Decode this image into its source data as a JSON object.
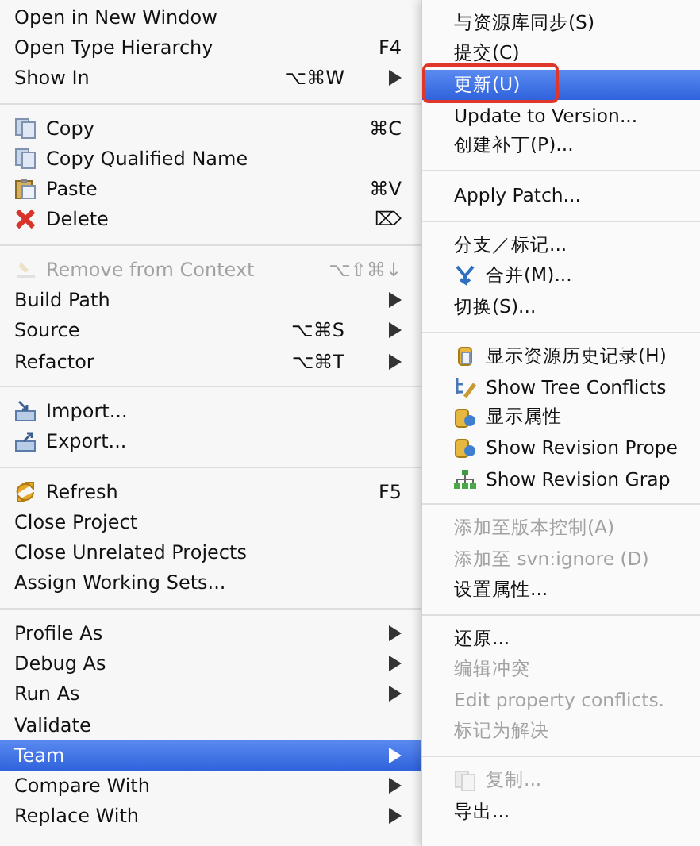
{
  "context_menu": {
    "groups": [
      [
        {
          "label": "Open in New Window",
          "submenu": false,
          "disabled": false,
          "selected": false
        },
        {
          "label": "Open Type Hierarchy",
          "shortcut": "F4",
          "submenu": false,
          "disabled": false,
          "selected": false
        },
        {
          "label": "Show In",
          "shortcut": "⌥⌘W",
          "submenu": true,
          "disabled": false,
          "selected": false
        }
      ],
      [
        {
          "label": "Copy",
          "shortcut": "⌘C",
          "submenu": false,
          "disabled": false,
          "selected": false
        },
        {
          "label": "Copy Qualified Name",
          "submenu": false,
          "disabled": false,
          "selected": false
        },
        {
          "label": "Paste",
          "shortcut": "⌘V",
          "submenu": false,
          "disabled": false,
          "selected": false
        },
        {
          "label": "Delete",
          "shortcut": "⌦",
          "submenu": false,
          "disabled": false,
          "selected": false
        }
      ],
      [
        {
          "label": "Remove from Context",
          "shortcut": "⌥⇧⌘↓",
          "submenu": false,
          "disabled": true,
          "selected": false
        },
        {
          "label": "Build Path",
          "submenu": true,
          "disabled": false,
          "selected": false
        },
        {
          "label": "Source",
          "shortcut": "⌥⌘S",
          "submenu": true,
          "disabled": false,
          "selected": false
        },
        {
          "label": "Refactor",
          "shortcut": "⌥⌘T",
          "submenu": true,
          "disabled": false,
          "selected": false
        }
      ],
      [
        {
          "label": "Import...",
          "submenu": false,
          "disabled": false,
          "selected": false
        },
        {
          "label": "Export...",
          "submenu": false,
          "disabled": false,
          "selected": false
        }
      ],
      [
        {
          "label": "Refresh",
          "shortcut": "F5",
          "submenu": false,
          "disabled": false,
          "selected": false
        },
        {
          "label": "Close Project",
          "submenu": false,
          "disabled": false,
          "selected": false
        },
        {
          "label": "Close Unrelated Projects",
          "submenu": false,
          "disabled": false,
          "selected": false
        },
        {
          "label": "Assign Working Sets...",
          "submenu": false,
          "disabled": false,
          "selected": false
        }
      ],
      [
        {
          "label": "Profile As",
          "submenu": true,
          "disabled": false,
          "selected": false
        },
        {
          "label": "Debug As",
          "submenu": true,
          "disabled": false,
          "selected": false
        },
        {
          "label": "Run As",
          "submenu": true,
          "disabled": false,
          "selected": false
        },
        {
          "label": "Validate",
          "submenu": false,
          "disabled": false,
          "selected": false
        },
        {
          "label": "Team",
          "submenu": true,
          "disabled": false,
          "selected": true
        },
        {
          "label": "Compare With",
          "submenu": true,
          "disabled": false,
          "selected": false
        },
        {
          "label": "Replace With",
          "submenu": true,
          "disabled": false,
          "selected": false
        }
      ]
    ]
  },
  "team_submenu": {
    "groups": [
      [
        {
          "label": "与资源库同步(S)",
          "disabled": false,
          "selected": false,
          "circled": false
        },
        {
          "label": "提交(C)",
          "disabled": false,
          "selected": false,
          "circled": false
        },
        {
          "label": "更新(U)",
          "disabled": false,
          "selected": true,
          "circled": true
        },
        {
          "label": "Update to Version...",
          "disabled": false,
          "selected": false,
          "circled": false
        },
        {
          "label": "创建补丁(P)...",
          "disabled": false,
          "selected": false,
          "circled": false
        }
      ],
      [
        {
          "label": "Apply Patch...",
          "disabled": false,
          "selected": false,
          "circled": false
        }
      ],
      [
        {
          "label": "分支／标记...",
          "disabled": false,
          "selected": false,
          "circled": false
        },
        {
          "label": "合并(M)...",
          "disabled": false,
          "selected": false,
          "circled": false
        },
        {
          "label": "切换(S)...",
          "disabled": false,
          "selected": false,
          "circled": false
        }
      ],
      [
        {
          "label": "显示资源历史记录(H)",
          "disabled": false,
          "selected": false,
          "circled": false
        },
        {
          "label": "Show Tree Conflicts",
          "disabled": false,
          "selected": false,
          "circled": false
        },
        {
          "label": "显示属性",
          "disabled": false,
          "selected": false,
          "circled": false
        },
        {
          "label": "Show Revision Prope",
          "disabled": false,
          "selected": false,
          "circled": false
        },
        {
          "label": "Show Revision Grap",
          "disabled": false,
          "selected": false,
          "circled": false
        }
      ],
      [
        {
          "label": "添加至版本控制(A)",
          "disabled": true,
          "selected": false,
          "circled": false
        },
        {
          "label": "添加至 svn:ignore (D)",
          "disabled": true,
          "selected": false,
          "circled": false
        },
        {
          "label": "设置属性...",
          "disabled": false,
          "selected": false,
          "circled": false
        }
      ],
      [
        {
          "label": "还原...",
          "disabled": false,
          "selected": false,
          "circled": false
        },
        {
          "label": "编辑冲突",
          "disabled": true,
          "selected": false,
          "circled": false
        },
        {
          "label": "Edit property conflicts.",
          "disabled": true,
          "selected": false,
          "circled": false
        },
        {
          "label": "标记为解决",
          "disabled": true,
          "selected": false,
          "circled": false
        }
      ],
      [
        {
          "label": "复制...",
          "disabled": true,
          "selected": false,
          "circled": false
        },
        {
          "label": "导出...",
          "disabled": false,
          "selected": false,
          "circled": false
        }
      ]
    ]
  }
}
